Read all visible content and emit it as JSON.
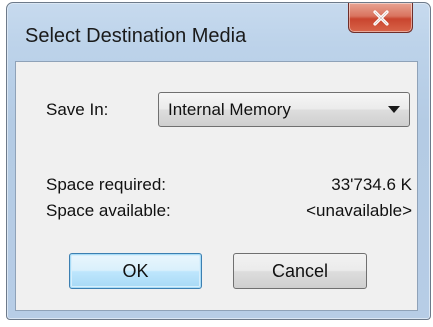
{
  "dialog": {
    "title": "Select Destination Media",
    "close_glyph": "X"
  },
  "save_in": {
    "label": "Save In:",
    "selected": "Internal Memory"
  },
  "space": {
    "required_label": "Space required:",
    "required_value": "33'734.6 K",
    "available_label": "Space available:",
    "available_value": "<unavailable>"
  },
  "buttons": {
    "ok": "OK",
    "cancel": "Cancel"
  },
  "icons": {
    "close": "close-icon",
    "dropdown": "chevron-down-icon"
  },
  "colors": {
    "frame": "#bdd3ea",
    "close_button": "#c9452f",
    "default_button_border": "#3c7fb1"
  }
}
